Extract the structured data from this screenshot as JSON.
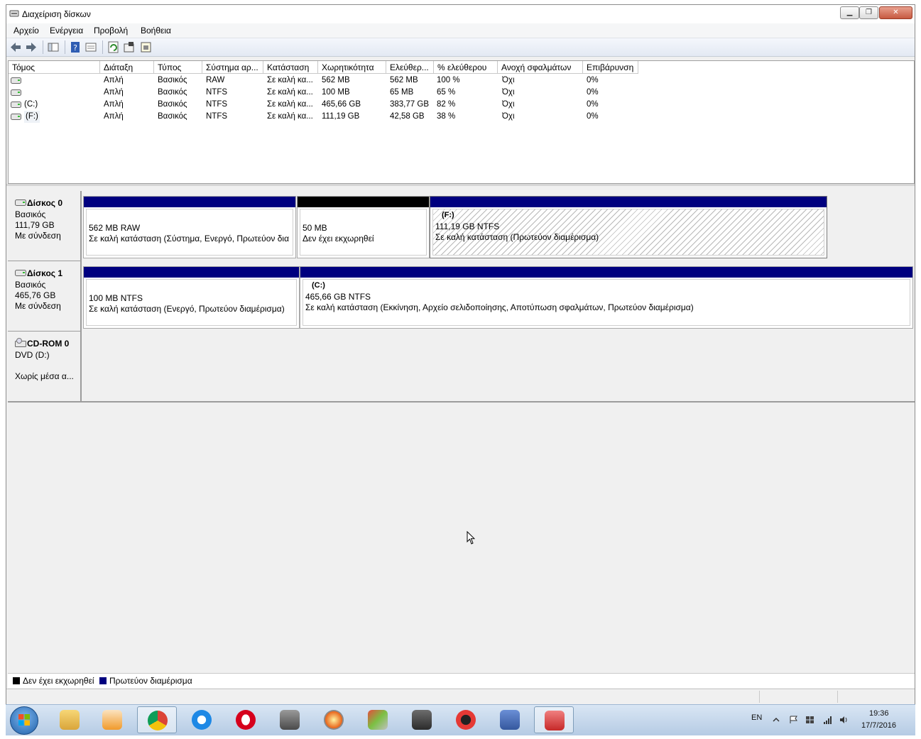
{
  "window": {
    "title": "Διαχείριση δίσκων"
  },
  "menu": [
    "Αρχείο",
    "Ενέργεια",
    "Προβολή",
    "Βοήθεια"
  ],
  "toolbar": {
    "icons": [
      "back-arrow-icon",
      "forward-arrow-icon",
      "console-tree-icon",
      "help-icon",
      "details-pane-icon",
      "refresh-icon",
      "properties-icon",
      "disk-wizard-icon"
    ]
  },
  "volume_table": {
    "columns": [
      "Τόμος",
      "Διάταξη",
      "Τύπος",
      "Σύστημα αρ...",
      "Κατάσταση",
      "Χωρητικότητα",
      "Ελεύθερ...",
      "% ελεύθερου",
      "Ανοχή σφαλμάτων",
      "Επιβάρυνση"
    ],
    "rows": [
      [
        "",
        "Απλή",
        "Βασικός",
        "RAW",
        "Σε καλή κα...",
        "562 MB",
        "562 MB",
        "100 %",
        "Όχι",
        "0%"
      ],
      [
        "",
        "Απλή",
        "Βασικός",
        "NTFS",
        "Σε καλή κα...",
        "100 MB",
        "65 MB",
        "65 %",
        "Όχι",
        "0%"
      ],
      [
        "(C:)",
        "Απλή",
        "Βασικός",
        "NTFS",
        "Σε καλή κα...",
        "465,66 GB",
        "383,77 GB",
        "82 %",
        "Όχι",
        "0%"
      ],
      [
        "(F:)",
        "Απλή",
        "Βασικός",
        "NTFS",
        "Σε καλή κα...",
        "111,19 GB",
        "42,58 GB",
        "38 %",
        "Όχι",
        "0%"
      ]
    ]
  },
  "disks": [
    {
      "name": "Δίσκος 0",
      "type": "Βασικός",
      "size": "111,79 GB",
      "status": "Με σύνδεση",
      "partitions": [
        {
          "title": "",
          "line1": "562 MB RAW",
          "line2": "Σε καλή κατάσταση (Σύστημα, Ενεργό, Πρωτεύον δια",
          "bar": "#00007f"
        },
        {
          "title": "",
          "line1": "50 MB",
          "line2": "Δεν έχει εκχωρηθεί",
          "bar": "#000000"
        },
        {
          "title": "(F:)",
          "line1": "111,19 GB NTFS",
          "line2": "Σε καλή κατάσταση (Πρωτεύον διαμέρισμα)",
          "bar": "#00007f"
        }
      ]
    },
    {
      "name": "Δίσκος 1",
      "type": "Βασικός",
      "size": "465,76 GB",
      "status": "Με σύνδεση",
      "partitions": [
        {
          "title": "",
          "line1": "100 MB NTFS",
          "line2": "Σε καλή κατάσταση (Ενεργό, Πρωτεύον διαμέρισμα)",
          "bar": "#00007f"
        },
        {
          "title": "(C:)",
          "line1": "465,66 GB NTFS",
          "line2": "Σε καλή κατάσταση (Εκκίνηση, Αρχείο σελιδοποίησης, Αποτύπωση σφαλμάτων, Πρωτεύον διαμέρισμα)",
          "bar": "#00007f"
        }
      ]
    },
    {
      "name": "CD-ROM 0",
      "type": "DVD (D:)",
      "size": "",
      "status": "Χωρίς μέσα α..."
    }
  ],
  "legend": [
    {
      "label": "Δεν έχει εκχωρηθεί",
      "color": "#000000"
    },
    {
      "label": "Πρωτεύον διαμέρισμα",
      "color": "#00007f"
    }
  ],
  "taskbar": {
    "apps": [
      "explorer-icon",
      "media-player-icon",
      "chrome-icon",
      "internet-explorer-icon",
      "opera-icon",
      "media-center-icon",
      "burning-app-icon",
      "disk-image-icon",
      "camera-app-icon",
      "game-booster-icon",
      "game-controller-icon",
      "disk-management-icon"
    ],
    "language": "EN",
    "time": "19:36",
    "date": "17/7/2016"
  }
}
